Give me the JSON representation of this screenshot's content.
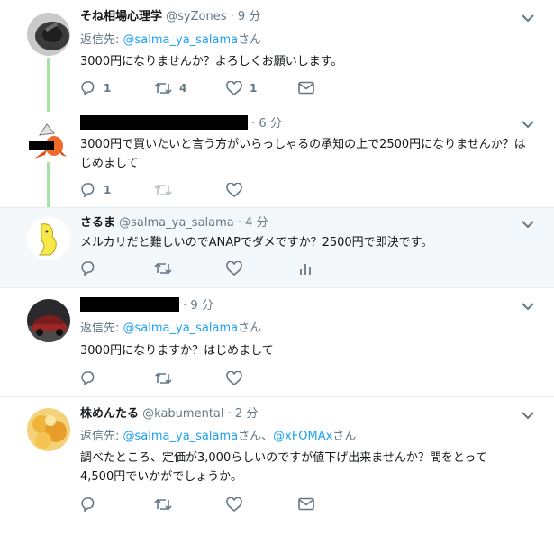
{
  "tweets": [
    {
      "name": "そね相場心理学",
      "handle": "@syZones",
      "time": "9 分",
      "reply_prefix": "返信先: ",
      "mentions": [
        "@salma_ya_salama"
      ],
      "reply_suffix": "さん",
      "text": "3000円になりませんか？よろしくお願いします。",
      "counts": {
        "reply": "1",
        "retweet": "4",
        "like": "1"
      }
    },
    {
      "time": "6 分",
      "text": "3000円で買いたいと言う方がいらっしゃるの承知の上で2500円になりませんか？はじめまして",
      "counts": {
        "reply": "1"
      }
    },
    {
      "name": "さるま",
      "handle": "@salma_ya_salama",
      "time": "4 分",
      "text": "メルカリだと難しいのでANAPでダメですか？2500円で即決です。"
    },
    {
      "time": "9 分",
      "reply_prefix": "返信先: ",
      "mentions": [
        "@salma_ya_salama"
      ],
      "reply_suffix": "さん",
      "text": "3000円になりますか？はじめまして"
    },
    {
      "name": "株めんたる",
      "handle": "@kabumental",
      "time": "2 分",
      "reply_prefix": "返信先: ",
      "mentions": [
        "@salma_ya_salama",
        "@xFOMAx"
      ],
      "mention_joiner": "さん、",
      "reply_suffix": "さん",
      "text_lines": [
        "調べたところ、定価が3,000らしいのですが値下げ出来ませんか？間をとって",
        "4,500円でいかがでしょうか。"
      ]
    }
  ],
  "separator_dot": "·",
  "colors": {
    "link": "#1da1f2",
    "muted": "#657786",
    "thread": "#a6e2a3",
    "highlight": "#f5f8fa"
  },
  "icons": [
    "reply-icon",
    "retweet-icon",
    "like-icon",
    "dm-icon",
    "analytics-icon",
    "caret-down-icon"
  ]
}
